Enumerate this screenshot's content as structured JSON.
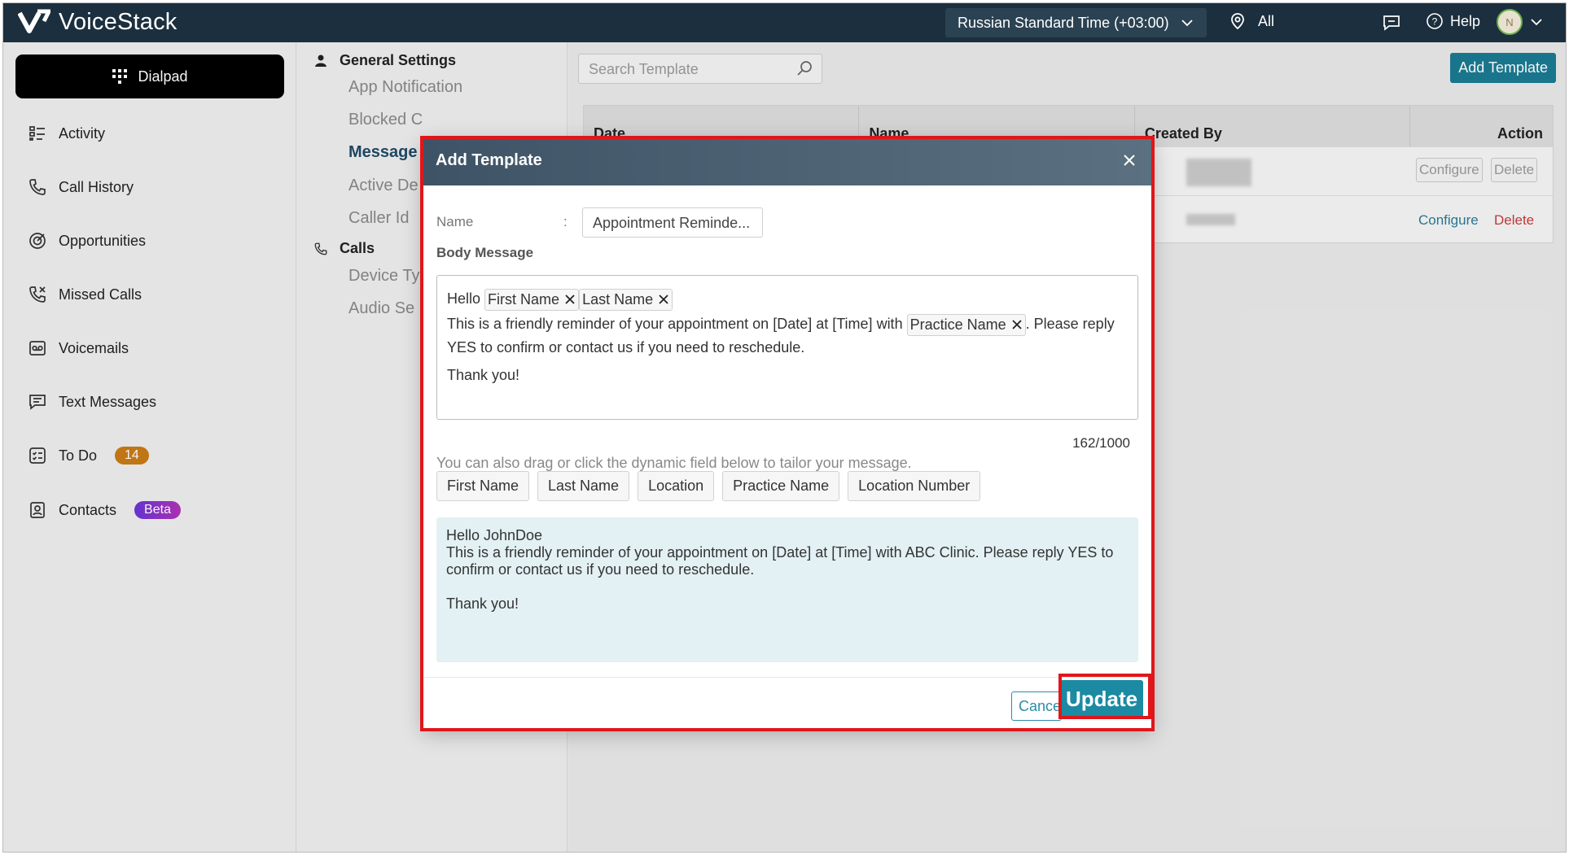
{
  "app": {
    "name": "VoiceStack"
  },
  "topbar": {
    "timezone": "Russian Standard Time (+03:00)",
    "location_label": "All",
    "help_label": "Help",
    "avatar_initial": "N"
  },
  "sidebar": {
    "dialpad_label": "Dialpad",
    "items": [
      {
        "label": "Activity",
        "icon": "activity-icon"
      },
      {
        "label": "Call History",
        "icon": "phone-icon"
      },
      {
        "label": "Opportunities",
        "icon": "opportunities-icon"
      },
      {
        "label": "Missed Calls",
        "icon": "missed-call-icon"
      },
      {
        "label": "Voicemails",
        "icon": "voicemail-icon"
      },
      {
        "label": "Text Messages",
        "icon": "message-icon"
      },
      {
        "label": "To Do",
        "icon": "todo-icon",
        "badge": "14"
      },
      {
        "label": "Contacts",
        "icon": "contacts-icon",
        "badge": "Beta"
      }
    ]
  },
  "settings": {
    "general_heading": "General Settings",
    "general_items": [
      "App Notification",
      "Blocked C",
      "Message",
      "Active De",
      "Caller Id"
    ],
    "calls_heading": "Calls",
    "calls_items": [
      "Device Ty",
      "Audio Se"
    ]
  },
  "main": {
    "search_placeholder": "Search Template",
    "add_template_label": "Add Template",
    "columns": [
      "Date",
      "Name",
      "Created By",
      "Action"
    ],
    "row_actions": {
      "configure": "Configure",
      "delete": "Delete"
    }
  },
  "modal": {
    "title": "Add Template",
    "name_label": "Name",
    "name_sep": ":",
    "name_value": "Appointment Reminde...",
    "body_label": "Body Message",
    "body": {
      "hello": "Hello",
      "chip_first": "First Name",
      "chip_last": "Last Name",
      "line2_a": "This is a friendly reminder of your appointment on [Date] at [Time] with",
      "chip_practice": "Practice Name",
      "line2_b": ". Please reply",
      "line3": "YES to confirm or contact us if you need to reschedule.",
      "thanks": "Thank you!"
    },
    "counter": "162/1000",
    "hint": "You can also drag or click the dynamic field below to tailor your message.",
    "dynamic_fields": [
      "First Name",
      "Last Name",
      "Location",
      "Practice Name",
      "Location Number"
    ],
    "preview": {
      "line1": "Hello JohnDoe",
      "line2": "This is a friendly reminder of your appointment on [Date] at [Time] with ABC Clinic. Please reply YES to confirm or contact us if you need to reschedule.",
      "line3": "Thank you!"
    },
    "cancel_label": "Cancel",
    "update_label": "Update"
  }
}
